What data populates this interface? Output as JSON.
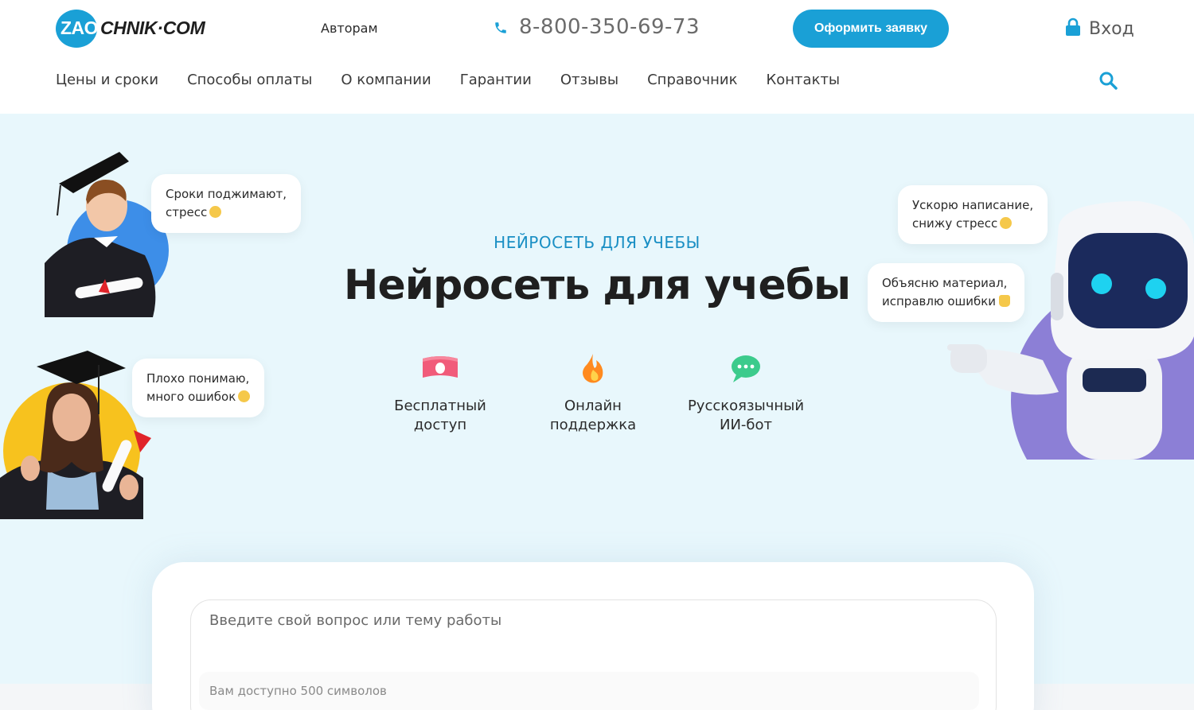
{
  "header": {
    "logo_prefix": "ZAO",
    "logo_suffix": "CHNIK·COM",
    "authors_link": "Авторам",
    "phone": "8-800-350-69-73",
    "cta_button": "Оформить заявку",
    "login": "Вход",
    "nav": [
      "Цены и сроки",
      "Способы оплаты",
      "О компании",
      "Гарантии",
      "Отзывы",
      "Справочник",
      "Контакты"
    ]
  },
  "hero": {
    "eyebrow": "НЕЙРОСЕТЬ ДЛЯ УЧЕБЫ",
    "title": "Нейросеть для учебы",
    "features": [
      {
        "icon": "banknote-icon",
        "line1": "Бесплатный",
        "line2": "доступ"
      },
      {
        "icon": "flame-icon",
        "line1": "Онлайн",
        "line2": "поддержка"
      },
      {
        "icon": "chat-bubble-icon",
        "line1": "Русскоязычный",
        "line2": "ИИ-бот"
      }
    ],
    "bubbles": {
      "student1_line1": "Сроки поджимают,",
      "student1_line2": "стресс",
      "student2_line1": "Плохо понимаю,",
      "student2_line2": "много ошибок",
      "robot1_line1": "Ускорю написание,",
      "robot1_line2": "снижу стресс",
      "robot2_line1": "Объясню материал,",
      "robot2_line2": "исправлю ошибки"
    }
  },
  "chat": {
    "placeholder": "Введите свой вопрос или тему работы",
    "counter": "Вам доступно 500 символов"
  },
  "colors": {
    "accent": "#1aa0d6",
    "hero_bg": "#e8f7fc",
    "robot_circle": "#8c7fd6",
    "student1_circle": "#3d8ee8",
    "student2_circle": "#f7c21e"
  }
}
